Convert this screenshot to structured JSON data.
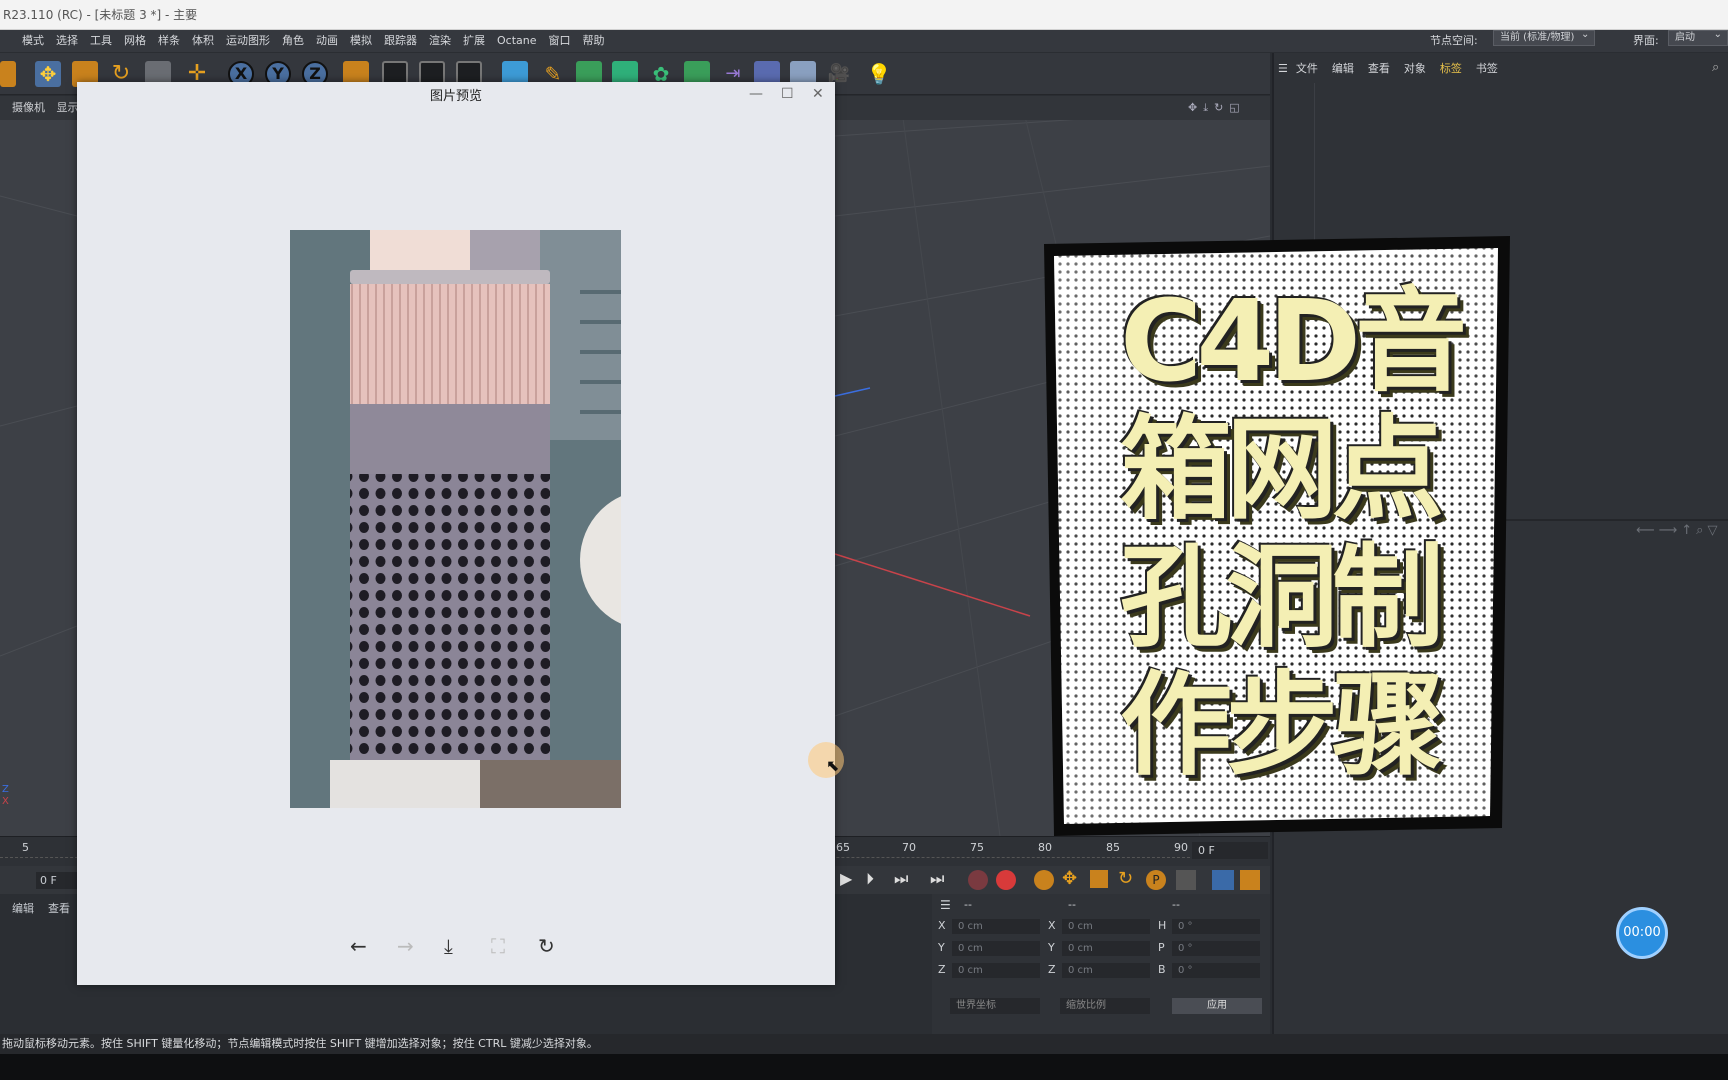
{
  "window": {
    "title": "R23.110 (RC) - [未标题 3 *] - 主要"
  },
  "menubar": {
    "items": [
      "模式",
      "选择",
      "工具",
      "网格",
      "样条",
      "体积",
      "运动图形",
      "角色",
      "动画",
      "模拟",
      "跟踪器",
      "渲染",
      "扩展",
      "Octane",
      "窗口",
      "帮助"
    ],
    "node_space_label": "节点空间:",
    "node_space_value": "当前 (标准/物理)",
    "layout_label": "界面:",
    "layout_value": "启动"
  },
  "viewport": {
    "menu": [
      "摄像机",
      "显示"
    ]
  },
  "right_panel": {
    "tabs": [
      "文件",
      "编辑",
      "查看",
      "对象",
      "标签",
      "书签"
    ]
  },
  "timeline": {
    "ticks": [
      "5",
      "65",
      "70",
      "75",
      "80",
      "85",
      "90"
    ],
    "current_frame": "0 F",
    "start_frame": "0 F"
  },
  "lower_tabs": [
    "编辑",
    "查看"
  ],
  "coords": {
    "headers": [
      "--",
      "--",
      "--"
    ],
    "rows": [
      {
        "a": "X",
        "av": "0 cm",
        "b": "X",
        "bv": "0 cm",
        "c": "H",
        "cv": "0 °"
      },
      {
        "a": "Y",
        "av": "0 cm",
        "b": "Y",
        "bv": "0 cm",
        "c": "P",
        "cv": "0 °"
      },
      {
        "a": "Z",
        "av": "0 cm",
        "b": "Z",
        "bv": "0 cm",
        "c": "B",
        "cv": "0 °"
      }
    ],
    "world": "世界坐标",
    "scale": "缩放比例",
    "apply": "应用"
  },
  "status": "拖动鼠标移动元素。按住 SHIFT 键量化移动；节点编辑模式时按住 SHIFT 键增加选择对象；按住 CTRL 键减少选择对象。",
  "preview": {
    "title": "图片预览",
    "buttons": [
      "←",
      "→",
      "⤓",
      "⛶",
      "↻"
    ]
  },
  "poster": {
    "lines": [
      "C4D音",
      "箱网点",
      "孔洞制",
      "作步骤"
    ]
  },
  "timer": "00:00",
  "colors": {
    "accent": "#2b8fe0",
    "poster_fill": "#f4efb4",
    "poster_shadow": "#3b3a1c"
  }
}
